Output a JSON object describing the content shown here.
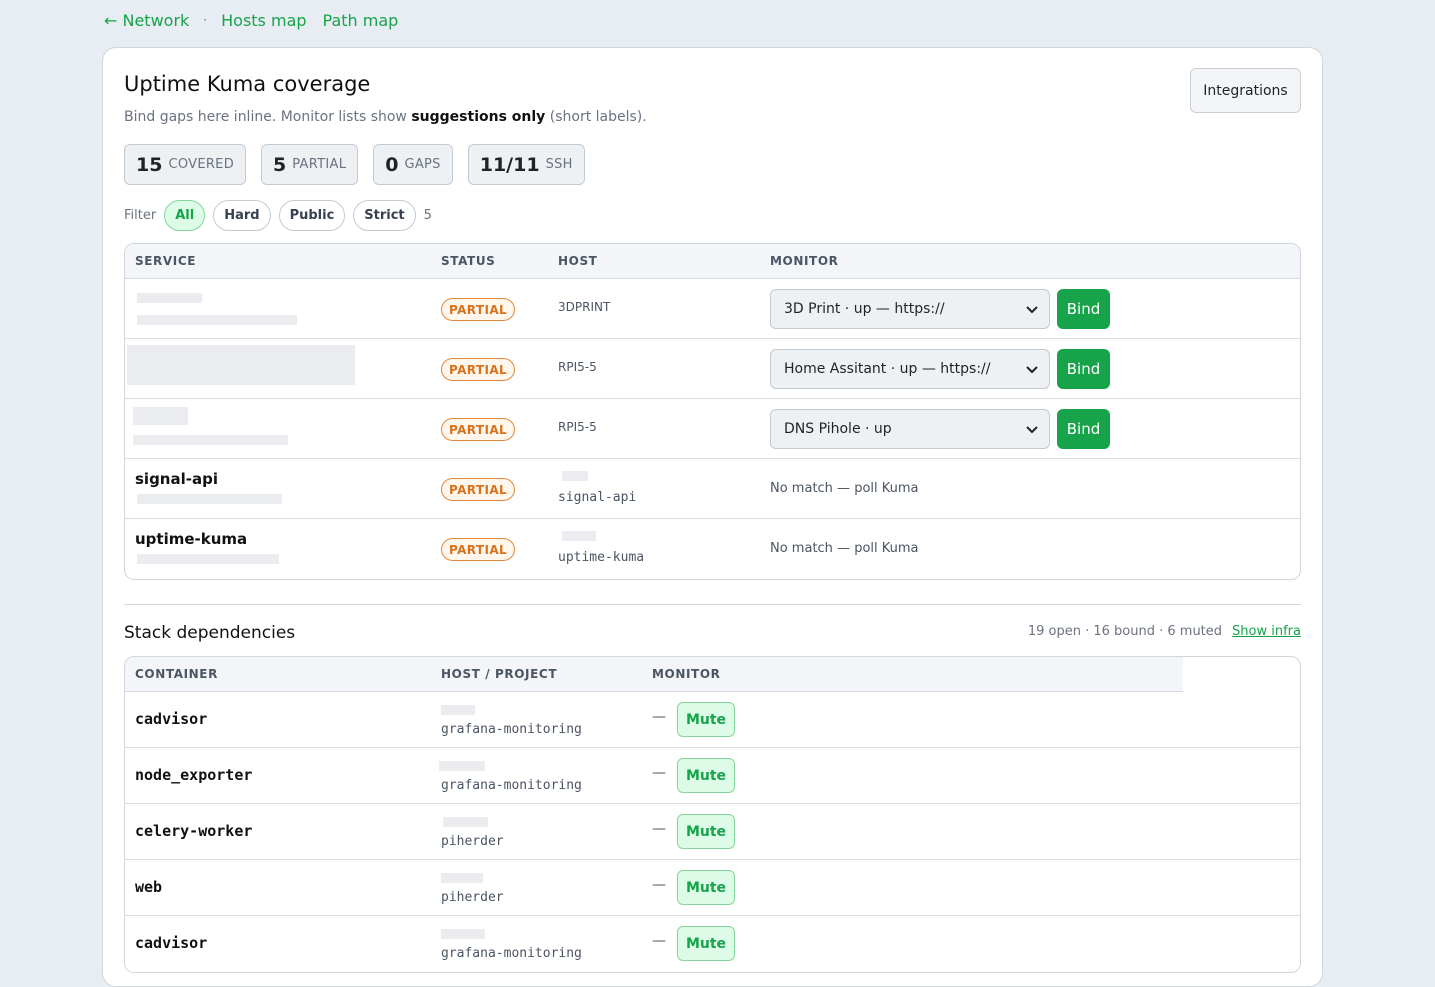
{
  "nav": {
    "back": "← Network",
    "sep": "·",
    "hosts_map": "Hosts map",
    "path_map": "Path map"
  },
  "card": {
    "title": "Uptime Kuma coverage",
    "subtitle_pre": "Bind gaps here inline. Monitor lists show ",
    "subtitle_bold": "suggestions only",
    "subtitle_post": " (short labels).",
    "integrations": "Integrations"
  },
  "stats": [
    {
      "num": "15",
      "label": "COVERED"
    },
    {
      "num": "5",
      "label": "PARTIAL"
    },
    {
      "num": "0",
      "label": "GAPS"
    },
    {
      "num": "11/11",
      "label": "SSH"
    }
  ],
  "filters": {
    "label": "Filter",
    "options": [
      "All",
      "Hard",
      "Public",
      "Strict"
    ],
    "active": "All",
    "count": "5"
  },
  "coverage_table": {
    "headers": [
      "SERVICE",
      "STATUS",
      "HOST",
      "MONITOR"
    ],
    "rows": [
      {
        "service": "",
        "status": "PARTIAL",
        "host": "3DPRINT",
        "monitor": "3D Print · up — https://",
        "action": "Bind"
      },
      {
        "service": "",
        "status": "PARTIAL",
        "host": "RPI5-5",
        "monitor": "Home Assitant · up — https://",
        "action": "Bind"
      },
      {
        "service": "",
        "status": "PARTIAL",
        "host": "RPI5-5",
        "monitor": "DNS Pihole · up",
        "action": "Bind"
      },
      {
        "service": "signal-api",
        "status": "PARTIAL",
        "host": "signal-api",
        "monitor": "No match — poll Kuma"
      },
      {
        "service": "uptime-kuma",
        "status": "PARTIAL",
        "host": "uptime-kuma",
        "monitor": "No match — poll Kuma"
      }
    ]
  },
  "dependencies": {
    "title": "Stack dependencies",
    "meta": "19 open · 16 bound · 6 muted",
    "show_infra": "Show infra",
    "headers": [
      "CONTAINER",
      "HOST / PROJECT",
      "MONITOR"
    ],
    "rows": [
      {
        "container": "cadvisor",
        "project": "grafana-monitoring",
        "monitor": "—",
        "action": "Mute"
      },
      {
        "container": "node_exporter",
        "project": "grafana-monitoring",
        "monitor": "—",
        "action": "Mute"
      },
      {
        "container": "celery-worker",
        "project": "piherder",
        "monitor": "—",
        "action": "Mute"
      },
      {
        "container": "web",
        "project": "piherder",
        "monitor": "—",
        "action": "Mute"
      },
      {
        "container": "cadvisor",
        "project": "grafana-monitoring",
        "monitor": "—",
        "action": "Mute"
      }
    ]
  },
  "colors": {
    "accent": "#16a34a",
    "partial": "#d9721c",
    "background": "#e8edf3"
  }
}
